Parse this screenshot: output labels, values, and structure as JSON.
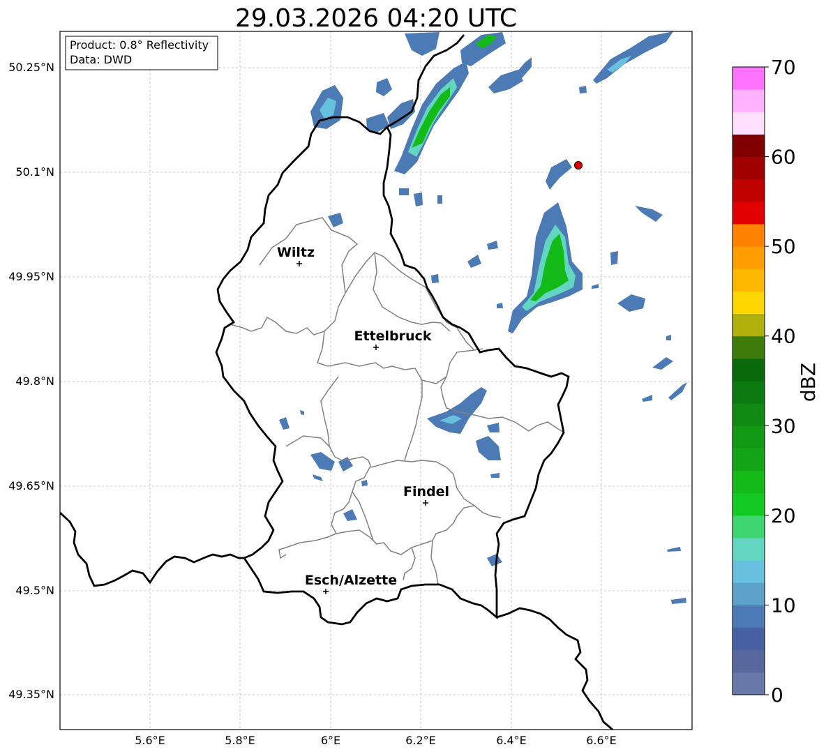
{
  "title": "29.03.2026 04:20 UTC",
  "info": {
    "product": "Product: 0.8° Reflectivity",
    "source": "Data: DWD"
  },
  "axes": {
    "lon_ticks": [
      "5.6°E",
      "5.8°E",
      "6°E",
      "6.2°E",
      "6.4°E",
      "6.6°E"
    ],
    "lat_ticks": [
      "50.25°N",
      "50.1°N",
      "49.95°N",
      "49.8°N",
      "49.65°N",
      "49.5°N",
      "49.35°N"
    ],
    "grid": true
  },
  "cities": [
    {
      "name": "Wiltz",
      "lon": 5.93,
      "lat": 49.966
    },
    {
      "name": "Ettelbruck",
      "lon": 6.1,
      "lat": 49.847
    },
    {
      "name": "Findel",
      "lon": 6.21,
      "lat": 49.626
    },
    {
      "name": "Esch/Alzette",
      "lon": 5.99,
      "lat": 49.5
    }
  ],
  "radar_site": {
    "lon": 6.548,
    "lat": 50.11,
    "color": "#e00000"
  },
  "colorbar": {
    "label": "dBZ",
    "ticks": [
      "0",
      "10",
      "20",
      "30",
      "40",
      "50",
      "60",
      "70"
    ],
    "min": 0,
    "max": 70,
    "step": 2.5,
    "colors": [
      "#6878a8",
      "#58689f",
      "#4660a3",
      "#4c7ab5",
      "#5da3c9",
      "#67c1de",
      "#63d6c2",
      "#3ed670",
      "#13ca22",
      "#13ba18",
      "#13a515",
      "#139a15",
      "#108a12",
      "#0b7a0f",
      "#0a6a0b",
      "#3f7b0b",
      "#b0b10a",
      "#ffd600",
      "#ffb800",
      "#ff9e00",
      "#ff8200",
      "#e30000",
      "#c10000",
      "#a00000",
      "#800000",
      "#ffe0ff",
      "#ffb3ff",
      "#ff73ff",
      "#ea33ea"
    ]
  }
}
